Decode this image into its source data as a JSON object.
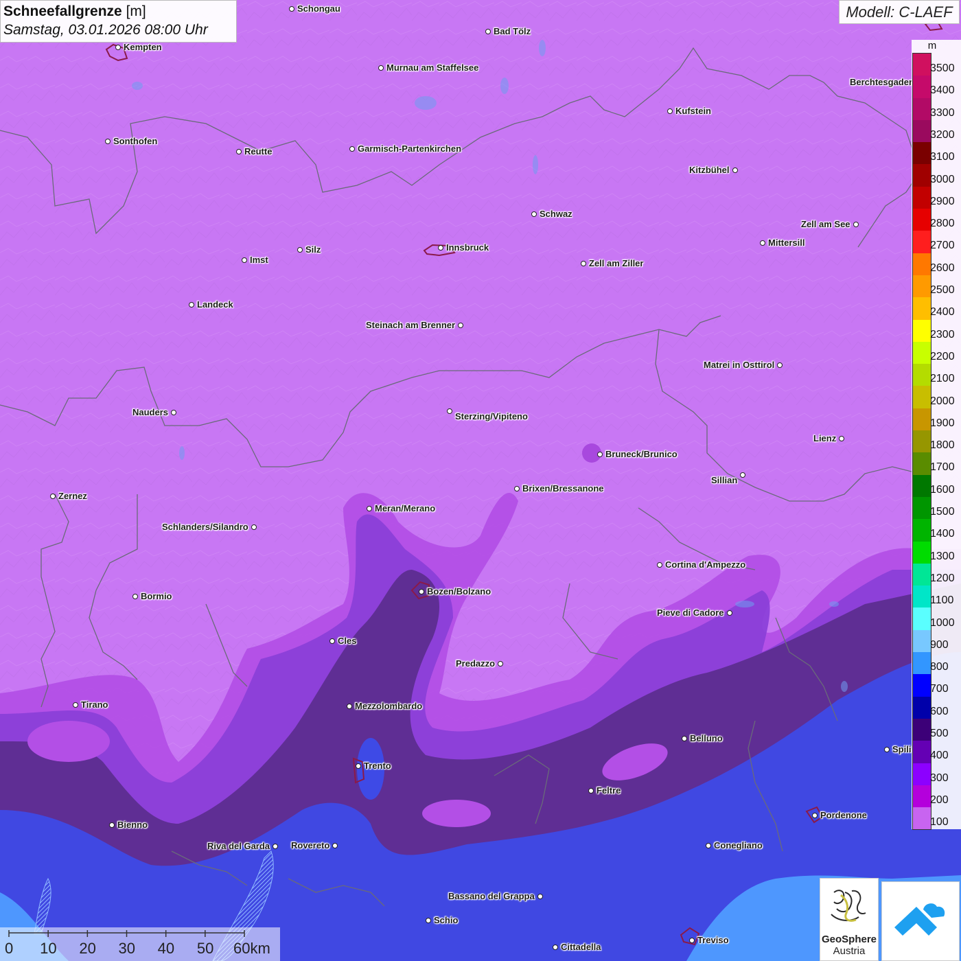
{
  "title": {
    "variable": "Schneefallgrenze",
    "unit": "[m]",
    "datetime": "Samstag, 03.01.2026 08:00 Uhr"
  },
  "model_label": "Modell: C-LAEF",
  "legend": {
    "unit": "m",
    "entries": [
      {
        "value": "3500",
        "color": "#d0105f"
      },
      {
        "value": "3400",
        "color": "#c50a6a"
      },
      {
        "value": "3300",
        "color": "#b20a66"
      },
      {
        "value": "3200",
        "color": "#9a0a5e"
      },
      {
        "value": "3100",
        "color": "#7a0000"
      },
      {
        "value": "3000",
        "color": "#a00000"
      },
      {
        "value": "2900",
        "color": "#c20000"
      },
      {
        "value": "2800",
        "color": "#e60000"
      },
      {
        "value": "2700",
        "color": "#ff1e1e"
      },
      {
        "value": "2600",
        "color": "#ff7800"
      },
      {
        "value": "2500",
        "color": "#ff9a00"
      },
      {
        "value": "2400",
        "color": "#ffbe00"
      },
      {
        "value": "2300",
        "color": "#ffff00"
      },
      {
        "value": "2200",
        "color": "#c8ff00"
      },
      {
        "value": "2100",
        "color": "#b4dc00"
      },
      {
        "value": "2000",
        "color": "#c8be00"
      },
      {
        "value": "1900",
        "color": "#c89600"
      },
      {
        "value": "1800",
        "color": "#969600"
      },
      {
        "value": "1700",
        "color": "#5a8c00"
      },
      {
        "value": "1600",
        "color": "#007800"
      },
      {
        "value": "1500",
        "color": "#009600"
      },
      {
        "value": "1400",
        "color": "#00b400"
      },
      {
        "value": "1300",
        "color": "#00dc00"
      },
      {
        "value": "1200",
        "color": "#00e696"
      },
      {
        "value": "1100",
        "color": "#00e6c8"
      },
      {
        "value": "1000",
        "color": "#5affff"
      },
      {
        "value": "900",
        "color": "#78c8ff"
      },
      {
        "value": "800",
        "color": "#3296ff"
      },
      {
        "value": "700",
        "color": "#0000ff"
      },
      {
        "value": "600",
        "color": "#0000aa"
      },
      {
        "value": "500",
        "color": "#3c0078"
      },
      {
        "value": "400",
        "color": "#6400b4"
      },
      {
        "value": "300",
        "color": "#8c00ff"
      },
      {
        "value": "200",
        "color": "#b400dc"
      },
      {
        "value": "100",
        "color": "#c864f0"
      }
    ]
  },
  "cities": [
    {
      "name": "Schongau"
    },
    {
      "name": "Bad Tölz"
    },
    {
      "name": "Kempten"
    },
    {
      "name": "Murnau am Staffelsee"
    },
    {
      "name": "Berchtesgaden"
    },
    {
      "name": "Kufstein"
    },
    {
      "name": "Sonthofen"
    },
    {
      "name": "Reutte"
    },
    {
      "name": "Garmisch-Partenkirchen"
    },
    {
      "name": "Kitzbühel"
    },
    {
      "name": "Schwaz"
    },
    {
      "name": "Zell am See"
    },
    {
      "name": "Mittersill"
    },
    {
      "name": "Imst"
    },
    {
      "name": "Silz"
    },
    {
      "name": "Innsbruck"
    },
    {
      "name": "Zell am Ziller"
    },
    {
      "name": "Landeck"
    },
    {
      "name": "Steinach am Brenner"
    },
    {
      "name": "Matrei in Osttirol"
    },
    {
      "name": "Nauders"
    },
    {
      "name": "Sterzing/Vipiteno"
    },
    {
      "name": "Lienz"
    },
    {
      "name": "Bruneck/Brunico"
    },
    {
      "name": "Sillian"
    },
    {
      "name": "Zernez"
    },
    {
      "name": "Brixen/Bressanone"
    },
    {
      "name": "Meran/Merano"
    },
    {
      "name": "Schlanders/Silandro"
    },
    {
      "name": "Cortina d'Ampezzo"
    },
    {
      "name": "Bormio"
    },
    {
      "name": "Bozen/Bolzano"
    },
    {
      "name": "Pieve di Cadore"
    },
    {
      "name": "Cles"
    },
    {
      "name": "Predazzo"
    },
    {
      "name": "Tirano"
    },
    {
      "name": "Mezzolombardo"
    },
    {
      "name": "Belluno"
    },
    {
      "name": "Spili"
    },
    {
      "name": "Trento"
    },
    {
      "name": "Feltre"
    },
    {
      "name": "Pordenone"
    },
    {
      "name": "Bienno"
    },
    {
      "name": "Riva del Garda"
    },
    {
      "name": "Rovereto"
    },
    {
      "name": "Conegliano"
    },
    {
      "name": "Bassano del Grappa"
    },
    {
      "name": "Schio"
    },
    {
      "name": "Treviso"
    },
    {
      "name": "Cittadella"
    }
  ],
  "scale_bar": {
    "labels": [
      "0",
      "10",
      "20",
      "30",
      "40",
      "50",
      "60km"
    ]
  },
  "logos": {
    "geosphere_name": "GeoSphere",
    "geosphere_country": "Austria",
    "app_icon": "cloud-arrow-icon"
  }
}
